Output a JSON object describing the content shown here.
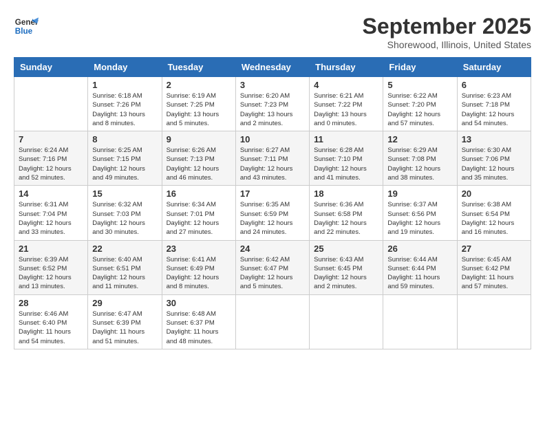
{
  "header": {
    "logo_line1": "General",
    "logo_line2": "Blue",
    "month": "September 2025",
    "location": "Shorewood, Illinois, United States"
  },
  "weekdays": [
    "Sunday",
    "Monday",
    "Tuesday",
    "Wednesday",
    "Thursday",
    "Friday",
    "Saturday"
  ],
  "weeks": [
    [
      {
        "day": "",
        "info": ""
      },
      {
        "day": "1",
        "info": "Sunrise: 6:18 AM\nSunset: 7:26 PM\nDaylight: 13 hours\nand 8 minutes."
      },
      {
        "day": "2",
        "info": "Sunrise: 6:19 AM\nSunset: 7:25 PM\nDaylight: 13 hours\nand 5 minutes."
      },
      {
        "day": "3",
        "info": "Sunrise: 6:20 AM\nSunset: 7:23 PM\nDaylight: 13 hours\nand 2 minutes."
      },
      {
        "day": "4",
        "info": "Sunrise: 6:21 AM\nSunset: 7:22 PM\nDaylight: 13 hours\nand 0 minutes."
      },
      {
        "day": "5",
        "info": "Sunrise: 6:22 AM\nSunset: 7:20 PM\nDaylight: 12 hours\nand 57 minutes."
      },
      {
        "day": "6",
        "info": "Sunrise: 6:23 AM\nSunset: 7:18 PM\nDaylight: 12 hours\nand 54 minutes."
      }
    ],
    [
      {
        "day": "7",
        "info": "Sunrise: 6:24 AM\nSunset: 7:16 PM\nDaylight: 12 hours\nand 52 minutes."
      },
      {
        "day": "8",
        "info": "Sunrise: 6:25 AM\nSunset: 7:15 PM\nDaylight: 12 hours\nand 49 minutes."
      },
      {
        "day": "9",
        "info": "Sunrise: 6:26 AM\nSunset: 7:13 PM\nDaylight: 12 hours\nand 46 minutes."
      },
      {
        "day": "10",
        "info": "Sunrise: 6:27 AM\nSunset: 7:11 PM\nDaylight: 12 hours\nand 43 minutes."
      },
      {
        "day": "11",
        "info": "Sunrise: 6:28 AM\nSunset: 7:10 PM\nDaylight: 12 hours\nand 41 minutes."
      },
      {
        "day": "12",
        "info": "Sunrise: 6:29 AM\nSunset: 7:08 PM\nDaylight: 12 hours\nand 38 minutes."
      },
      {
        "day": "13",
        "info": "Sunrise: 6:30 AM\nSunset: 7:06 PM\nDaylight: 12 hours\nand 35 minutes."
      }
    ],
    [
      {
        "day": "14",
        "info": "Sunrise: 6:31 AM\nSunset: 7:04 PM\nDaylight: 12 hours\nand 33 minutes."
      },
      {
        "day": "15",
        "info": "Sunrise: 6:32 AM\nSunset: 7:03 PM\nDaylight: 12 hours\nand 30 minutes."
      },
      {
        "day": "16",
        "info": "Sunrise: 6:34 AM\nSunset: 7:01 PM\nDaylight: 12 hours\nand 27 minutes."
      },
      {
        "day": "17",
        "info": "Sunrise: 6:35 AM\nSunset: 6:59 PM\nDaylight: 12 hours\nand 24 minutes."
      },
      {
        "day": "18",
        "info": "Sunrise: 6:36 AM\nSunset: 6:58 PM\nDaylight: 12 hours\nand 22 minutes."
      },
      {
        "day": "19",
        "info": "Sunrise: 6:37 AM\nSunset: 6:56 PM\nDaylight: 12 hours\nand 19 minutes."
      },
      {
        "day": "20",
        "info": "Sunrise: 6:38 AM\nSunset: 6:54 PM\nDaylight: 12 hours\nand 16 minutes."
      }
    ],
    [
      {
        "day": "21",
        "info": "Sunrise: 6:39 AM\nSunset: 6:52 PM\nDaylight: 12 hours\nand 13 minutes."
      },
      {
        "day": "22",
        "info": "Sunrise: 6:40 AM\nSunset: 6:51 PM\nDaylight: 12 hours\nand 11 minutes."
      },
      {
        "day": "23",
        "info": "Sunrise: 6:41 AM\nSunset: 6:49 PM\nDaylight: 12 hours\nand 8 minutes."
      },
      {
        "day": "24",
        "info": "Sunrise: 6:42 AM\nSunset: 6:47 PM\nDaylight: 12 hours\nand 5 minutes."
      },
      {
        "day": "25",
        "info": "Sunrise: 6:43 AM\nSunset: 6:45 PM\nDaylight: 12 hours\nand 2 minutes."
      },
      {
        "day": "26",
        "info": "Sunrise: 6:44 AM\nSunset: 6:44 PM\nDaylight: 11 hours\nand 59 minutes."
      },
      {
        "day": "27",
        "info": "Sunrise: 6:45 AM\nSunset: 6:42 PM\nDaylight: 11 hours\nand 57 minutes."
      }
    ],
    [
      {
        "day": "28",
        "info": "Sunrise: 6:46 AM\nSunset: 6:40 PM\nDaylight: 11 hours\nand 54 minutes."
      },
      {
        "day": "29",
        "info": "Sunrise: 6:47 AM\nSunset: 6:39 PM\nDaylight: 11 hours\nand 51 minutes."
      },
      {
        "day": "30",
        "info": "Sunrise: 6:48 AM\nSunset: 6:37 PM\nDaylight: 11 hours\nand 48 minutes."
      },
      {
        "day": "",
        "info": ""
      },
      {
        "day": "",
        "info": ""
      },
      {
        "day": "",
        "info": ""
      },
      {
        "day": "",
        "info": ""
      }
    ]
  ]
}
